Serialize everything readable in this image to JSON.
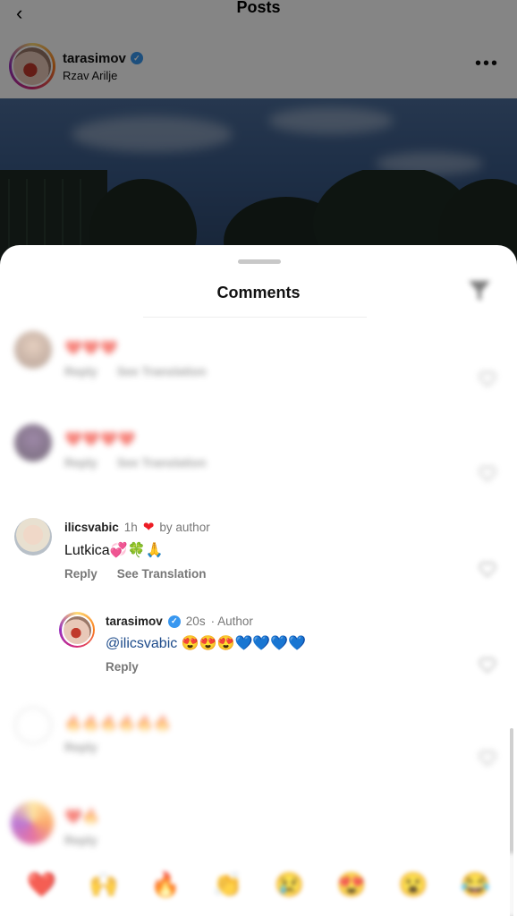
{
  "post": {
    "page_title": "Posts",
    "username": "tarasimov",
    "location": "Rzav Arilje"
  },
  "sheet": {
    "title": "Comments"
  },
  "comments": [
    {
      "username": "",
      "time": "",
      "text": "❤️❤️❤️",
      "reply": "Reply",
      "translate": "See Translation"
    },
    {
      "username": "",
      "time": "",
      "text": "❤️❤️❤️❤️",
      "reply": "Reply",
      "translate": "See Translation"
    },
    {
      "username": "ilicsvabic",
      "time": "1h",
      "badge": "by author",
      "text": "Lutkica💞🍀🙏",
      "reply": "Reply",
      "translate": "See Translation"
    },
    {
      "username": "tarasimov",
      "time": "20s",
      "badge": "· Author",
      "mention": "@ilicsvabic",
      "text": "😍😍😍💙💙💙💙",
      "reply": "Reply"
    },
    {
      "username": "",
      "time": "",
      "text": "🔥🔥🔥🔥🔥🔥",
      "reply": "Reply"
    },
    {
      "username": "",
      "time": "",
      "text": "❤️🔥",
      "reply": "Reply"
    }
  ],
  "reactions": [
    "❤️",
    "🙌",
    "🔥",
    "👏",
    "😢",
    "😍",
    "😮",
    "😂"
  ],
  "colors": {
    "verified": "#3897f0",
    "mention": "#1c4a8a",
    "heart": "#ed1c24"
  }
}
